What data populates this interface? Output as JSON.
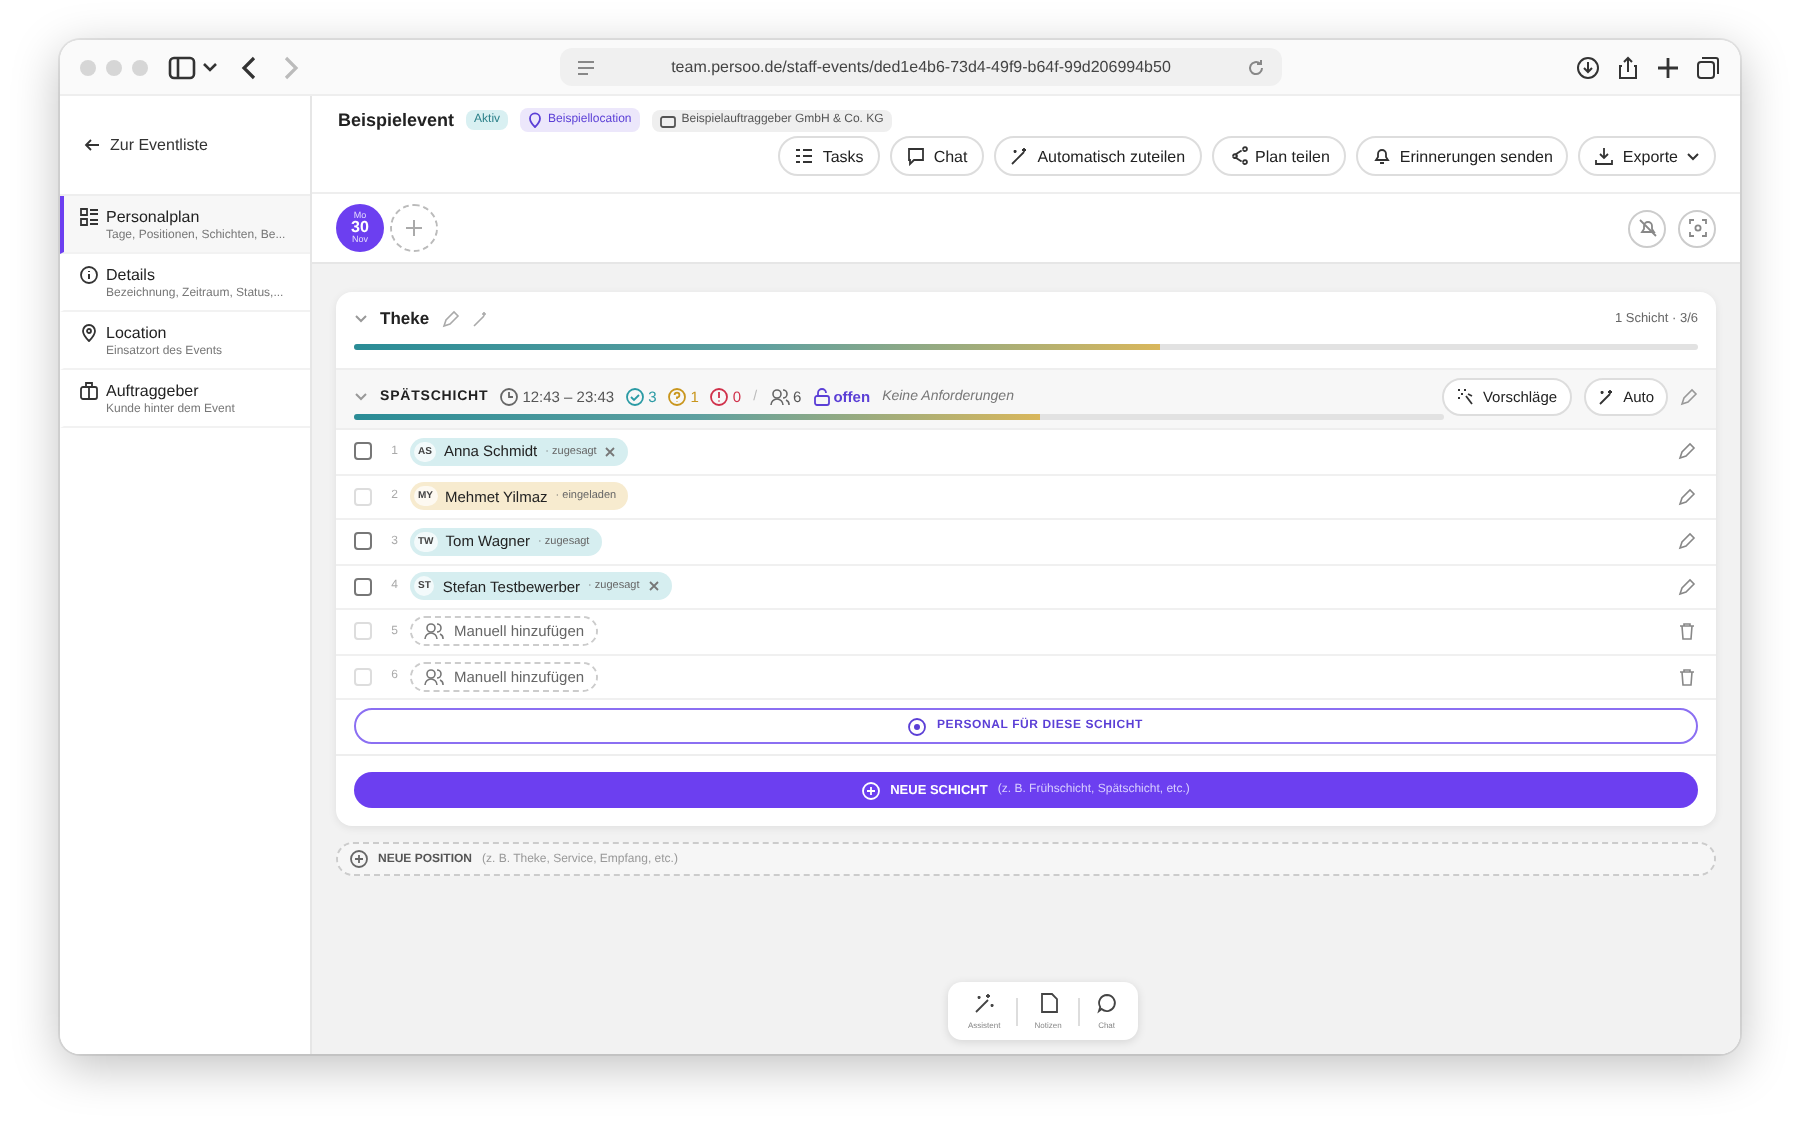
{
  "browser": {
    "url": "team.persoo.de/staff-events/ded1e4b6-73d4-49f9-b64f-99d206994b50"
  },
  "header": {
    "back_link": "Zur Eventliste",
    "title": "Beispielevent",
    "status_badge": "Aktiv",
    "location_badge": "Beispiellocation",
    "client_badge": "Beispielauftraggeber GmbH & Co. KG",
    "actions": [
      {
        "label": "Tasks",
        "kind": "button"
      },
      {
        "label": "Chat",
        "kind": "button"
      },
      {
        "label": "Automatisch zuteilen",
        "kind": "button"
      },
      {
        "label": "Plan teilen",
        "kind": "button"
      },
      {
        "label": "Erinnerungen senden",
        "kind": "button"
      },
      {
        "label": "Exporte",
        "kind": "menu"
      }
    ]
  },
  "sidebar": {
    "items": [
      {
        "title": "Personalplan",
        "subtitle": "Tage, Positionen, Schichten, Be...",
        "selected": true
      },
      {
        "title": "Details",
        "subtitle": "Bezeichnung, Zeitraum, Status,...",
        "selected": false
      },
      {
        "title": "Location",
        "subtitle": "Einsatzort des Events",
        "selected": false
      },
      {
        "title": "Auftraggeber",
        "subtitle": "Kunde hinter dem Event",
        "selected": false
      }
    ]
  },
  "dates": [
    {
      "weekday": "Mo",
      "day": "30",
      "month": "Nov",
      "selected": true
    }
  ],
  "position": {
    "name": "Theke",
    "summary": "1 Schicht · 3/6",
    "level": 0.6,
    "shift": {
      "name": "SPÄTSCHICHT",
      "time": "12:43 – 23:43",
      "confirmed": "3",
      "pending": "1",
      "declined": "0",
      "separator": "/",
      "capacity": "6",
      "status": "offen",
      "requirements": "Keine Anforderungen",
      "level": 0.63,
      "suggest_button": "Vorschläge",
      "auto_button": "Auto",
      "slots": [
        {
          "number": "1",
          "kind": "person",
          "initials": "AS",
          "name": "Anna Schmidt",
          "status": "· zugesagt",
          "removable": true,
          "disabled": false,
          "color": "#d6eef0"
        },
        {
          "number": "2",
          "kind": "person",
          "initials": "MY",
          "name": "Mehmet Yilmaz",
          "status": "· eingeladen",
          "removable": false,
          "disabled": true,
          "color": "#f7ebcf"
        },
        {
          "number": "3",
          "kind": "person",
          "initials": "TW",
          "name": "Tom Wagner",
          "status": "· zugesagt",
          "removable": false,
          "disabled": false,
          "color": "#d6eef0"
        },
        {
          "number": "4",
          "kind": "person",
          "initials": "ST",
          "name": "Stefan Testbewerber",
          "status": "· zugesagt",
          "removable": true,
          "disabled": false,
          "color": "#d6eef0"
        },
        {
          "number": "5",
          "kind": "empty",
          "label": "Manuell hinzufügen",
          "disabled": true
        },
        {
          "number": "6",
          "kind": "empty",
          "label": "Manuell hinzufügen",
          "disabled": true
        }
      ],
      "add_staff_button": "PERSONAL FÜR DIESE SCHICHT"
    },
    "new_shift_button": {
      "label": "NEUE SCHICHT",
      "hint": "(z. B. Frühschicht, Spätschicht, etc.)"
    }
  },
  "new_position_button": {
    "label": "NEUE POSITION",
    "hint": "(z. B. Theke, Service, Empfang, etc.)"
  },
  "dock": [
    {
      "label": "Assistent"
    },
    {
      "label": "Notizen"
    },
    {
      "label": "Chat"
    }
  ]
}
